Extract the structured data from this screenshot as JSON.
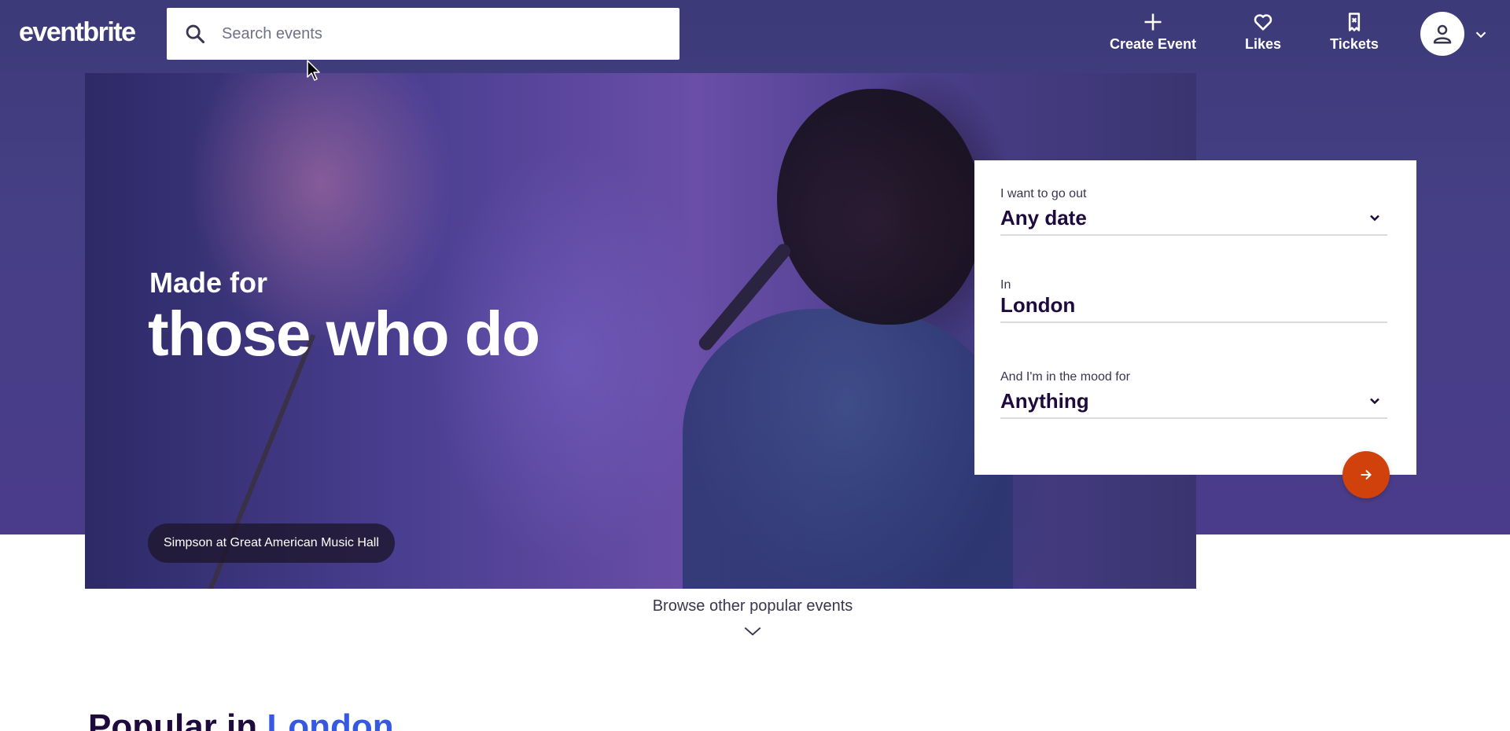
{
  "header": {
    "logo": "eventbrite",
    "search_placeholder": "Search events",
    "nav": {
      "create_event": "Create Event",
      "likes": "Likes",
      "tickets": "Tickets"
    }
  },
  "hero": {
    "subtitle": "Made for",
    "title": "those who do",
    "caption": "Simpson at Great American Music Hall"
  },
  "filters": {
    "date_label": "I want to go out",
    "date_value": "Any date",
    "location_label": "In",
    "location_value": "London",
    "mood_label": "And I'm in the mood for",
    "mood_value": "Anything"
  },
  "browse": {
    "label": "Browse other popular events"
  },
  "popular": {
    "prefix": "Popular in",
    "city": "London"
  },
  "colors": {
    "accent_orange": "#d1410c",
    "link_blue": "#3659e3",
    "hero_purple": "#463f86"
  }
}
